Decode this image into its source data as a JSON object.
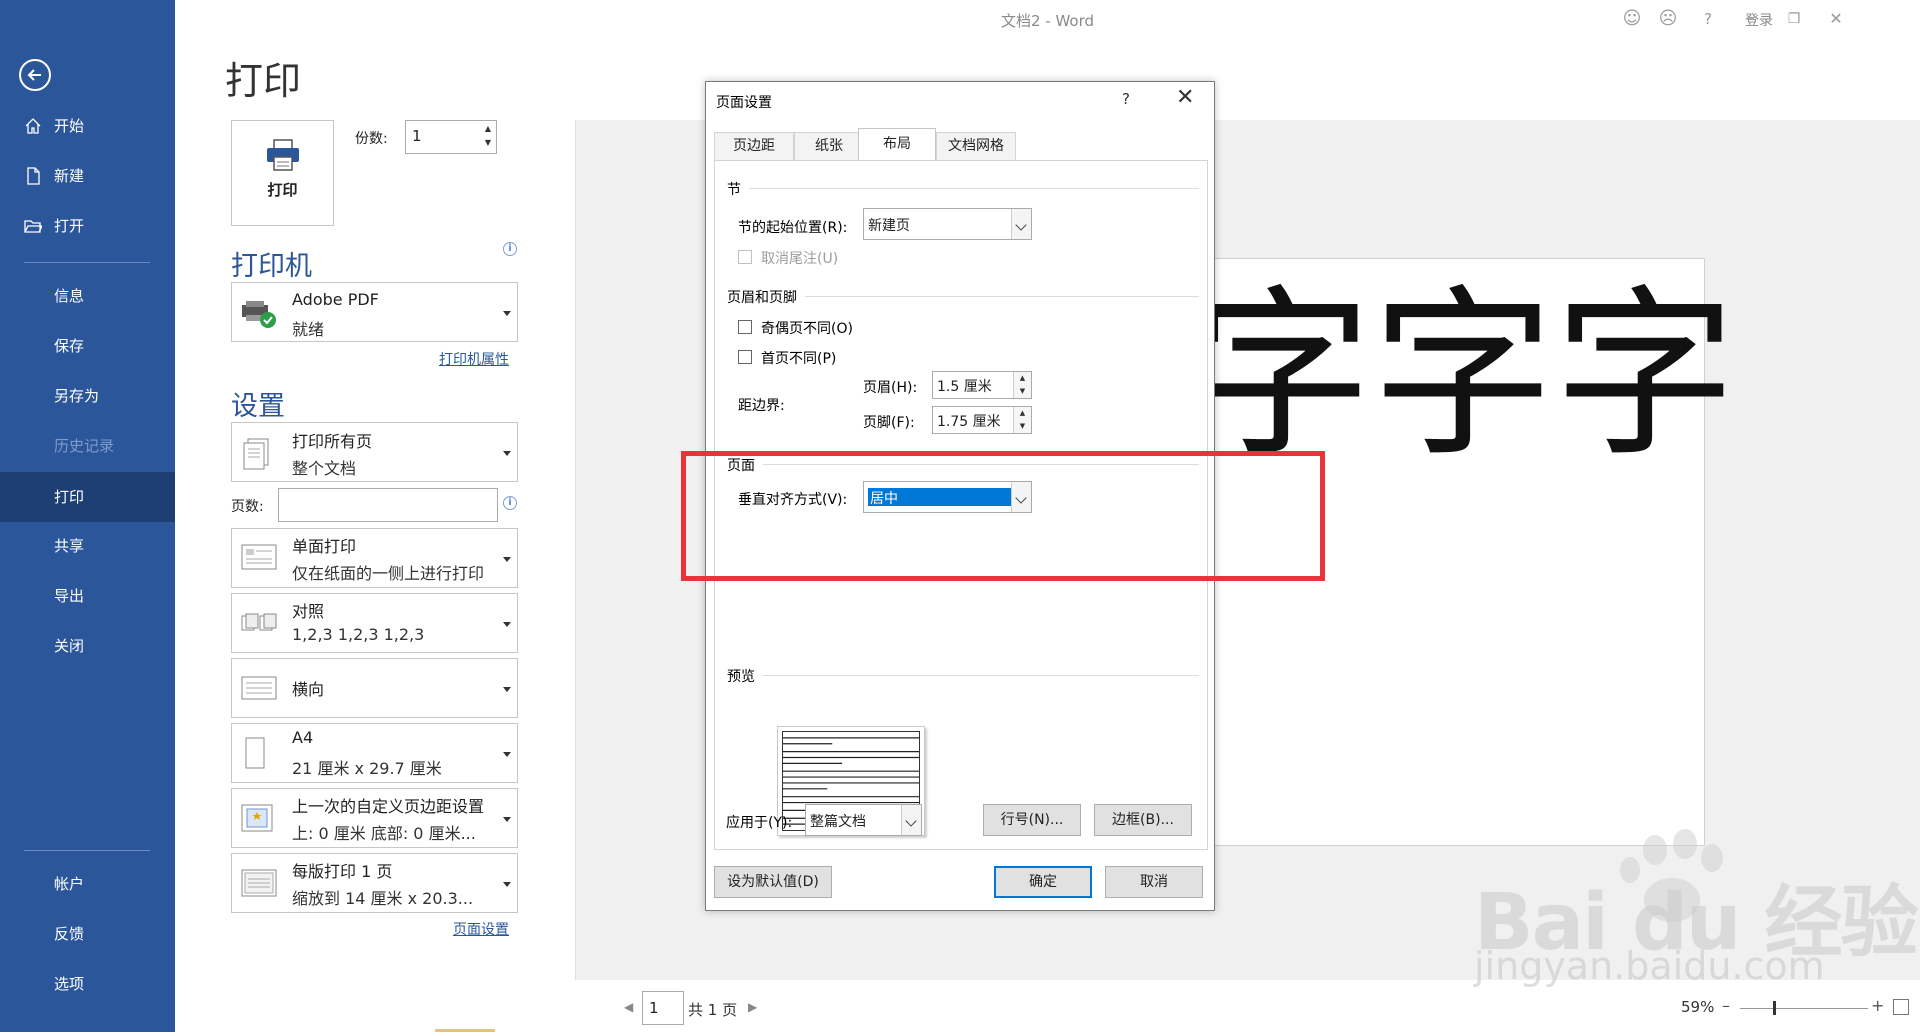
{
  "titlebar": {
    "doc_title": "文档2  -  Word",
    "login": "登录"
  },
  "sidebar": {
    "items": [
      {
        "label": "开始",
        "icon": "home-icon"
      },
      {
        "label": "新建",
        "icon": "new-document-icon"
      },
      {
        "label": "打开",
        "icon": "folder-open-icon"
      },
      {
        "label": "信息"
      },
      {
        "label": "保存"
      },
      {
        "label": "另存为"
      },
      {
        "label": "历史记录"
      },
      {
        "label": "打印"
      },
      {
        "label": "共享"
      },
      {
        "label": "导出"
      },
      {
        "label": "关闭"
      },
      {
        "label": "帐户"
      },
      {
        "label": "反馈"
      },
      {
        "label": "选项"
      }
    ]
  },
  "print_panel": {
    "heading": "打印",
    "print_button_label": "打印",
    "copies_label": "份数:",
    "copies_value": "1",
    "printer_heading": "打印机",
    "printer": {
      "name": "Adobe PDF",
      "status": "就绪"
    },
    "printer_props_link": "打印机属性",
    "settings_heading": "设置",
    "pages_label": "页数:",
    "settings": [
      {
        "main": "打印所有页",
        "sub": "整个文档"
      },
      {
        "main": "单面打印",
        "sub": "仅在纸面的一侧上进行打印"
      },
      {
        "main": "对照",
        "sub": "1,2,3    1,2,3    1,2,3"
      },
      {
        "main": "横向",
        "sub": ""
      },
      {
        "main": "A4",
        "sub": "21 厘米 x 29.7 厘米"
      },
      {
        "main": "上一次的自定义页边距设置",
        "sub": "上: 0 厘米 底部: 0 厘米..."
      },
      {
        "main": "每版打印 1 页",
        "sub": "缩放到 14 厘米 x 20.3..."
      }
    ],
    "page_setup_link": "页面设置"
  },
  "preview": {
    "text": "字字字",
    "page_number": "1",
    "page_total": "共 1 页",
    "zoom": "59%"
  },
  "dialog": {
    "title": "页面设置",
    "help": "?",
    "close": "✕",
    "tabs": [
      "页边距",
      "纸张",
      "布局",
      "文档网格"
    ],
    "section_group": "节",
    "section_start_label": "节的起始位置(R):",
    "section_start_value": "新建页",
    "suppress_endnotes": "取消尾注(U)",
    "header_footer_group": "页眉和页脚",
    "odd_even_diff": "奇偶页不同(O)",
    "first_page_diff": "首页不同(P)",
    "from_edge_label": "距边界:",
    "header_label": "页眉(H):",
    "header_value": "1.5 厘米",
    "footer_label": "页脚(F):",
    "footer_value": "1.75 厘米",
    "page_group": "页面",
    "vertical_align_label": "垂直对齐方式(V):",
    "vertical_align_value": "居中",
    "preview_group": "预览",
    "apply_to_label": "应用于(Y):",
    "apply_to_value": "整篇文档",
    "line_numbers_button": "行号(N)...",
    "borders_button": "边框(B)...",
    "set_default_button": "设为默认值(D)",
    "ok_button": "确定",
    "cancel_button": "取消"
  },
  "watermark": {
    "brand": "Bai du 经验",
    "url": "jingyan.baidu.com"
  },
  "colors": {
    "sidebar": "#2b579a",
    "sidebar_active": "#1e3f73",
    "highlight": "#e8333a",
    "selection": "#0078d7"
  }
}
